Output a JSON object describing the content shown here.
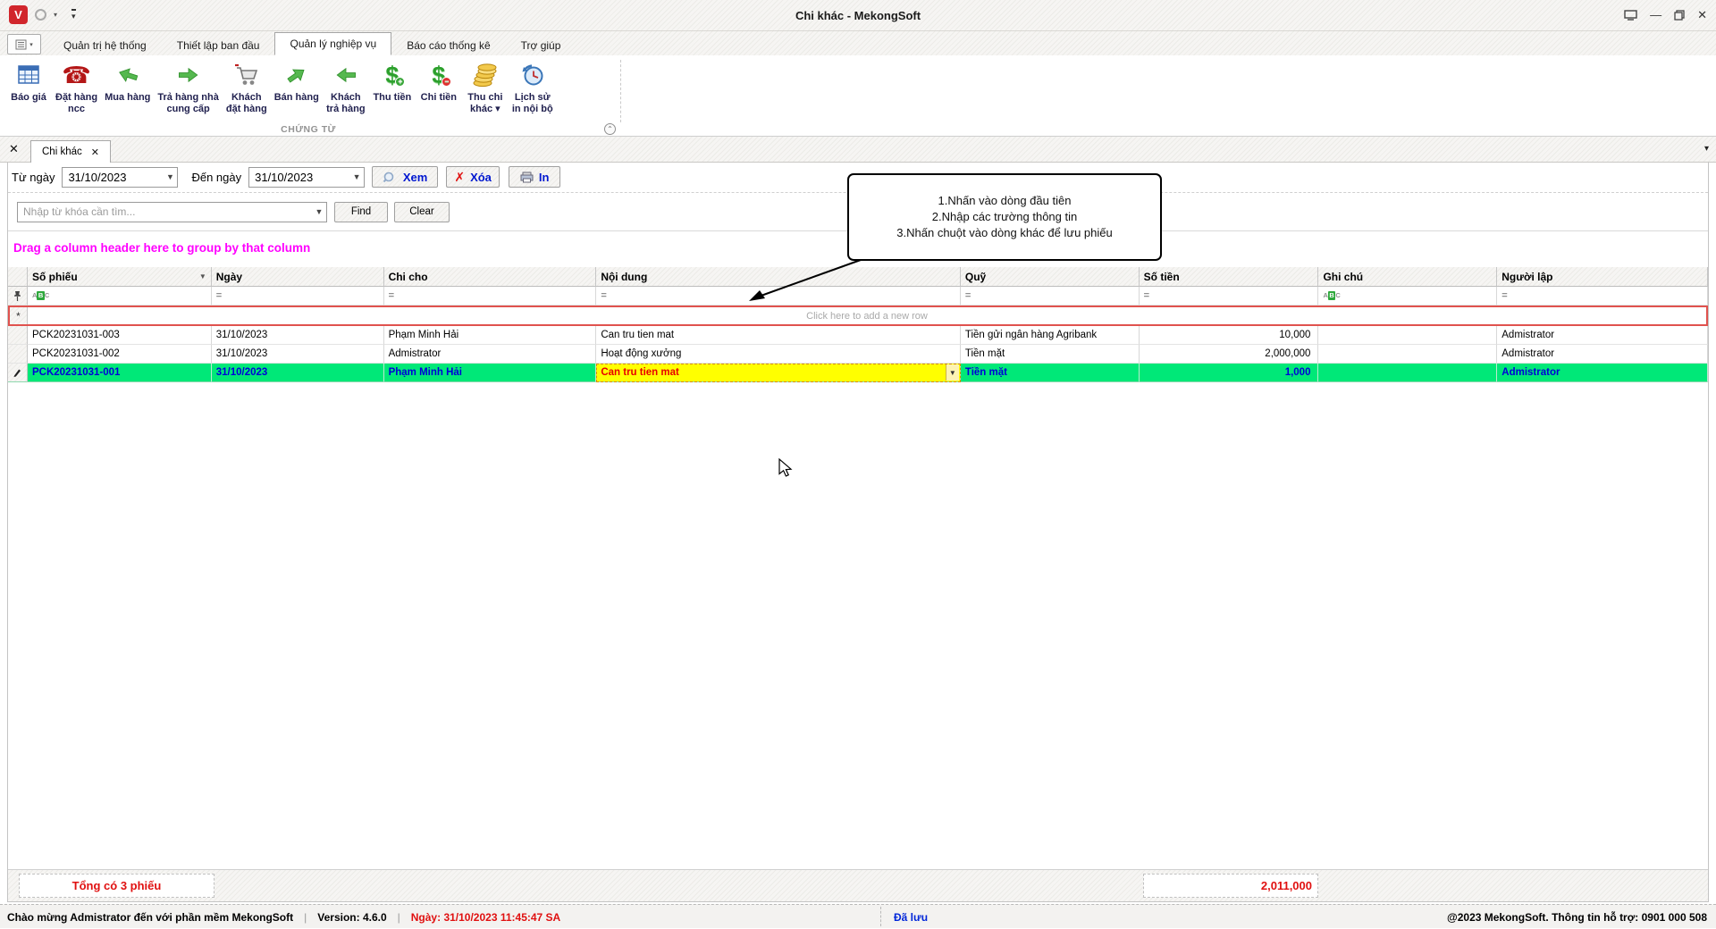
{
  "window": {
    "title": "Chi khác - MekongSoft"
  },
  "ribbon": {
    "tabs": [
      "Quản trị hệ thống",
      "Thiết lập ban đầu",
      "Quản lý nghiệp vụ",
      "Báo cáo thống kê",
      "Trợ giúp"
    ],
    "group_label": "CHỨNG TỪ",
    "buttons": [
      {
        "label": "Báo giá"
      },
      {
        "label": "Đặt hàng\nncc"
      },
      {
        "label": "Mua hàng"
      },
      {
        "label": "Trả hàng nhà\ncung cấp"
      },
      {
        "label": "Khách\nđặt hàng"
      },
      {
        "label": "Bán hàng"
      },
      {
        "label": "Khách\ntrả hàng"
      },
      {
        "label": "Thu tiền"
      },
      {
        "label": "Chi tiền"
      },
      {
        "label": "Thu chi\nkhác ▾"
      },
      {
        "label": "Lịch sử\nin nội bộ"
      }
    ]
  },
  "doc_tab": {
    "label": "Chi khác"
  },
  "filter_bar": {
    "from_label": "Từ ngày",
    "from_value": "31/10/2023",
    "to_label": "Đến ngày",
    "to_value": "31/10/2023",
    "view_label": "Xem",
    "delete_label": "Xóa",
    "print_label": "In"
  },
  "search_bar": {
    "placeholder": "Nhập từ khóa cần tìm...",
    "find_label": "Find",
    "clear_label": "Clear"
  },
  "grid": {
    "group_hint": "Drag a column header here to group by that column",
    "columns": [
      "Số phiếu",
      "Ngày",
      "Chi cho",
      "Nội dung",
      "Quỹ",
      "Số tiền",
      "Ghi chú",
      "Người lập"
    ],
    "eq_symbol": "=",
    "abc": [
      "A",
      "B",
      "C"
    ],
    "new_row_marker": "*",
    "new_row_hint": "Click here to add a new row",
    "rows": [
      {
        "cells": [
          "PCK20231031-003",
          "31/10/2023",
          "Phạm Minh Hải",
          "Can tru tien mat",
          "Tiền gửi ngân hàng Agribank",
          "10,000",
          "",
          "Admistrator"
        ]
      },
      {
        "cells": [
          "PCK20231031-002",
          "31/10/2023",
          "Admistrator",
          "Hoạt động xưởng",
          "Tiền mặt",
          "2,000,000",
          "",
          "Admistrator"
        ]
      },
      {
        "cells": [
          "PCK20231031-001",
          "31/10/2023",
          "Phạm Minh Hải",
          "Can tru tien mat",
          "Tiền mặt",
          "1,000",
          "",
          "Admistrator"
        ]
      }
    ],
    "summary": {
      "count_text": "Tổng có 3 phiếu",
      "total": "2,011,000"
    }
  },
  "callout": {
    "lines": [
      "1.Nhấn vào dòng đầu tiên",
      "2.Nhập các trường thông tin",
      "3.Nhấn chuột vào dòng khác để lưu phiếu"
    ]
  },
  "status_bar": {
    "welcome": "Chào mừng Admistrator đến với phần mềm MekongSoft",
    "separator": "|",
    "version": "Version: 4.6.0",
    "date": "Ngày: 31/10/2023 11:45:47 SA",
    "saved": "Đã lưu",
    "copyright": "@2023 MekongSoft. Thông tin hỗ trợ: 0901 000 508"
  },
  "colors": {
    "accent_blue": "#0017D0",
    "magenta": "#FF00FF",
    "selected_green": "#00E878",
    "editing_yellow": "#FFFF00",
    "alert_red": "#E01010"
  }
}
